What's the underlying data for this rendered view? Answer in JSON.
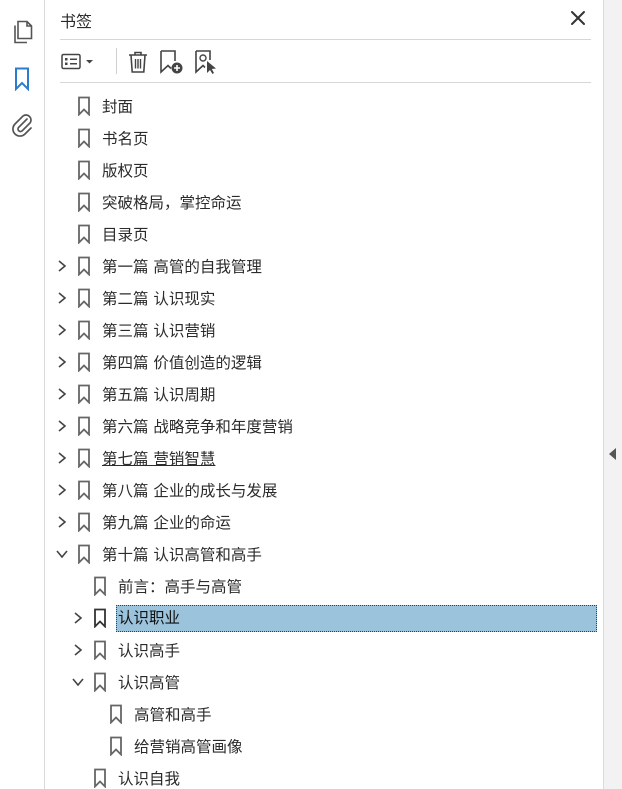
{
  "panel": {
    "title": "书签"
  },
  "bookmarks": [
    {
      "label": "封面",
      "level": 0,
      "chevron": "none"
    },
    {
      "label": "书名页",
      "level": 0,
      "chevron": "none"
    },
    {
      "label": "版权页",
      "level": 0,
      "chevron": "none"
    },
    {
      "label": "突破格局，掌控命运",
      "level": 0,
      "chevron": "none"
    },
    {
      "label": "目录页",
      "level": 0,
      "chevron": "none"
    },
    {
      "label": "第一篇  高管的自我管理",
      "level": 0,
      "chevron": "right"
    },
    {
      "label": "第二篇  认识现实",
      "level": 0,
      "chevron": "right"
    },
    {
      "label": "第三篇  认识营销",
      "level": 0,
      "chevron": "right"
    },
    {
      "label": "第四篇  价值创造的逻辑",
      "level": 0,
      "chevron": "right"
    },
    {
      "label": "第五篇  认识周期",
      "level": 0,
      "chevron": "right"
    },
    {
      "label": "第六篇  战略竞争和年度营销",
      "level": 0,
      "chevron": "right"
    },
    {
      "label": "第七篇  营销智慧",
      "level": 0,
      "chevron": "right",
      "underline": true
    },
    {
      "label": "第八篇  企业的成长与发展",
      "level": 0,
      "chevron": "right"
    },
    {
      "label": "第九篇  企业的命运",
      "level": 0,
      "chevron": "right"
    },
    {
      "label": "第十篇  认识高管和高手",
      "level": 0,
      "chevron": "down"
    },
    {
      "label": "前言：高手与高管",
      "level": 1,
      "chevron": "none"
    },
    {
      "label": "认识职业",
      "level": 1,
      "chevron": "right",
      "selected": true
    },
    {
      "label": "认识高手",
      "level": 1,
      "chevron": "right"
    },
    {
      "label": "认识高管",
      "level": 1,
      "chevron": "down"
    },
    {
      "label": "高管和高手",
      "level": 2,
      "chevron": "none"
    },
    {
      "label": "给营销高管画像",
      "level": 2,
      "chevron": "none"
    },
    {
      "label": "认识自我",
      "level": 1,
      "chevron": "none"
    }
  ],
  "icons": {
    "rail": [
      "pages-icon",
      "bookmark-icon",
      "paperclip-icon"
    ],
    "toolbar": [
      "options-menu-icon",
      "delete-icon",
      "new-bookmark-icon",
      "bookmark-from-selection-icon"
    ],
    "close": "close-icon"
  },
  "colors": {
    "accent": "#2b7bd1",
    "selection": "#9cc3dc"
  }
}
